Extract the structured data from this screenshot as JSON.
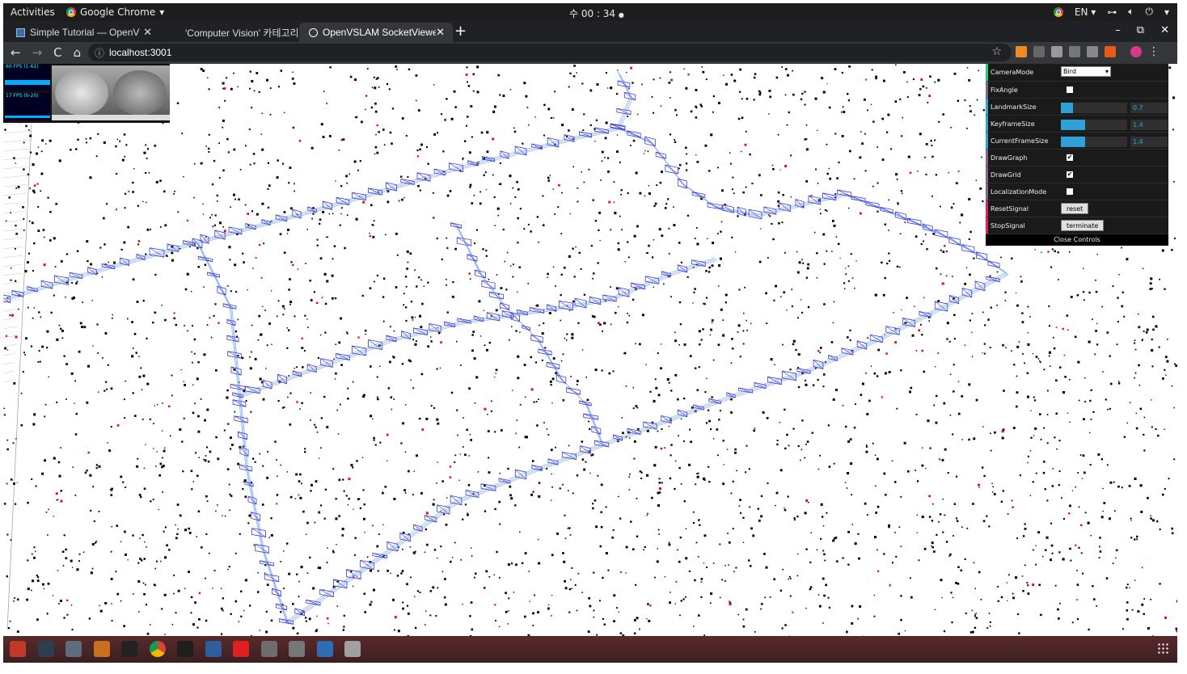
{
  "topbar": {
    "activities": "Activities",
    "app_name": "Google Chrome",
    "app_menu_arrow": "▾",
    "clock": "수 00 : 34",
    "clock_dot": "●",
    "lang": "EN ▾",
    "icons": [
      "network-icon",
      "volume-icon",
      "power-icon"
    ],
    "menu_arrow": "▾"
  },
  "tabs": [
    {
      "title": "Simple Tutorial — OpenV",
      "close": "✕",
      "active": false
    },
    {
      "title": "'Computer Vision' 카테고리",
      "close": "✕",
      "active": false
    },
    {
      "title": "OpenVSLAM SocketViewe",
      "close": "✕",
      "active": true
    }
  ],
  "newtab": "+",
  "window_buttons": [
    "–",
    "⧉",
    "✕"
  ],
  "toolbar": {
    "back": "←",
    "forward": "→",
    "reload": "C",
    "home": "⌂",
    "info": "ⓘ",
    "url": "localhost:3001",
    "star": "☆",
    "menu": "⋮"
  },
  "stats": {
    "fps_top": "60 FPS (1-61)",
    "fps_bottom": "17 FPS (0-20)"
  },
  "gui": {
    "camera_mode": {
      "label": "CameraMode",
      "value": "Bird"
    },
    "fix_angle": {
      "label": "FixAngle",
      "checked": false
    },
    "landmark_size": {
      "label": "LandmarkSize",
      "value": "0.7",
      "fill": 0.18
    },
    "keyframe_size": {
      "label": "KeyframeSize",
      "value": "1.4",
      "fill": 0.37
    },
    "current_frame_size": {
      "label": "CurrentFrameSize",
      "value": "1.4",
      "fill": 0.37
    },
    "draw_graph": {
      "label": "DrawGraph",
      "checked": true
    },
    "draw_grid": {
      "label": "DrawGrid",
      "checked": true
    },
    "localization_mode": {
      "label": "LocalizationMode",
      "checked": false
    },
    "reset_signal": {
      "label": "ResetSignal",
      "button": "reset"
    },
    "stop_signal": {
      "label": "StopSignal",
      "button": "terminate"
    },
    "close": "Close Controls"
  },
  "scene": {
    "keyframe_color": "#3a3ad8",
    "graph_color": "#8fb6ee",
    "landmark_color": "#000000",
    "local_landmark_color": "#e01010"
  },
  "dock": {
    "icons": [
      "settings-icon",
      "calculator-icon",
      "calendar-icon",
      "files-icon",
      "terminal-icon",
      "chrome-icon",
      "pycharm-icon",
      "rocket-icon",
      "media-player-icon",
      "store-icon",
      "game-icon",
      "document-viewer-icon",
      "text-editor-icon"
    ]
  }
}
